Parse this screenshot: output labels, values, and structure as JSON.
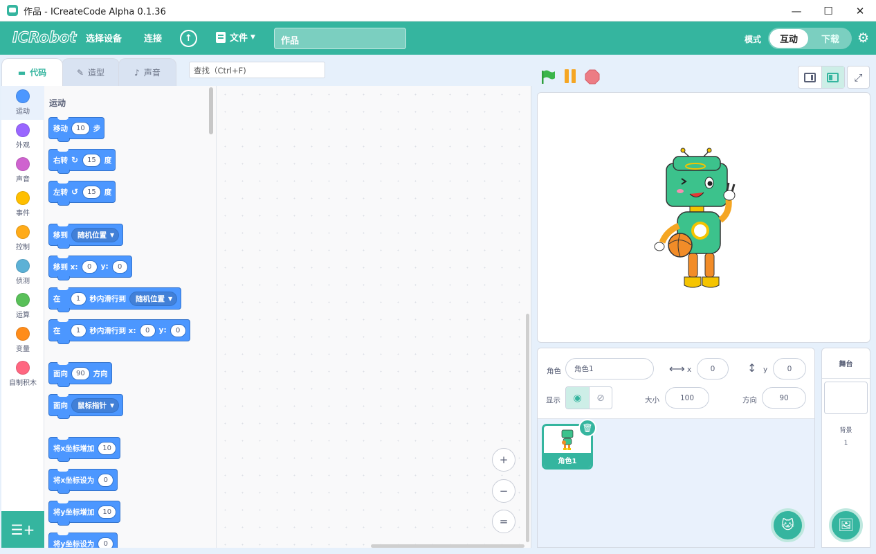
{
  "window": {
    "title": "作品 - ICreateCode Alpha 0.1.36",
    "minimize": "—",
    "maximize": "☐",
    "close": "✕"
  },
  "menubar": {
    "logo": "ICRobot",
    "select_device": "选择设备",
    "connect": "连接",
    "file": "文件",
    "project_title": "作品",
    "mode_label": "模式",
    "mode_interactive": "互动",
    "mode_download": "下载"
  },
  "tabs": {
    "code": "代码",
    "costumes": "造型",
    "sounds": "声音"
  },
  "search": {
    "placeholder": "查找（Ctrl+F)"
  },
  "categories": [
    {
      "label": "运动",
      "color": "#4c97ff"
    },
    {
      "label": "外观",
      "color": "#9966ff"
    },
    {
      "label": "声音",
      "color": "#cf63cf"
    },
    {
      "label": "事件",
      "color": "#ffbf00"
    },
    {
      "label": "控制",
      "color": "#ffab19"
    },
    {
      "label": "侦测",
      "color": "#5cb1d6"
    },
    {
      "label": "运算",
      "color": "#59c059"
    },
    {
      "label": "变量",
      "color": "#ff8c1a"
    },
    {
      "label": "自制积木",
      "color": "#ff6680"
    }
  ],
  "palette": {
    "heading": "运动",
    "blocks": {
      "move": {
        "a": "移动",
        "v": "10",
        "b": "步"
      },
      "turn_right": {
        "a": "右转",
        "v": "15",
        "b": "度"
      },
      "turn_left": {
        "a": "左转",
        "v": "15",
        "b": "度"
      },
      "goto": {
        "a": "移到",
        "d": "随机位置"
      },
      "goto_xy": {
        "a": "移到 x:",
        "x": "0",
        "b": "y:",
        "y": "0"
      },
      "glide": {
        "a": "在",
        "v": "1",
        "b": "秒内滑行到",
        "d": "随机位置"
      },
      "glide_xy": {
        "a": "在",
        "v": "1",
        "b": "秒内滑行到 x:",
        "x": "0",
        "c": "y:",
        "y": "0"
      },
      "point_dir": {
        "a": "面向",
        "v": "90",
        "b": "方向"
      },
      "point_to": {
        "a": "面向",
        "d": "鼠标指针"
      },
      "change_x": {
        "a": "将x坐标增加",
        "v": "10"
      },
      "set_x": {
        "a": "将x坐标设为",
        "v": "0"
      },
      "change_y": {
        "a": "将y坐标增加",
        "v": "10"
      },
      "set_y": {
        "a": "将y坐标设为",
        "v": "0"
      }
    }
  },
  "zoom": {
    "in": "+",
    "out": "−",
    "reset": "="
  },
  "sprite_info": {
    "sprite_label": "角色",
    "sprite_name": "角色1",
    "x_label": "x",
    "x_value": "0",
    "y_label": "y",
    "y_value": "0",
    "show_label": "显示",
    "size_label": "大小",
    "size_value": "100",
    "direction_label": "方向",
    "direction_value": "90"
  },
  "sprites": [
    {
      "name": "角色1"
    }
  ],
  "stage_pane": {
    "title": "舞台",
    "backdrop_label": "背景",
    "backdrop_count": "1"
  },
  "colors": {
    "accent": "#35b59f",
    "motion": "#4c97ff",
    "flag": "#3bb54a",
    "pause": "#f5a623",
    "stop": "#ec7c84"
  }
}
